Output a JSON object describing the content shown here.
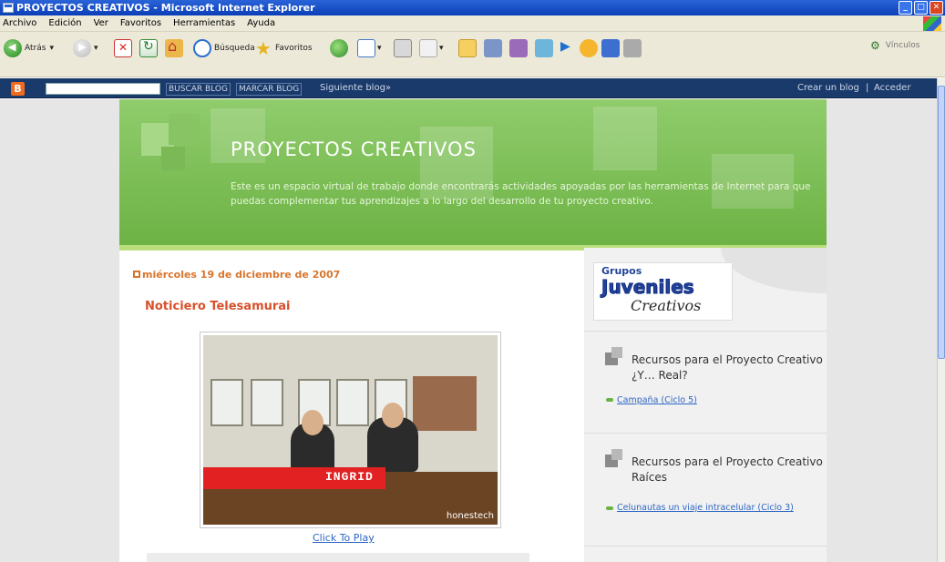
{
  "window": {
    "title": "PROYECTOS CREATIVOS - Microsoft Internet Explorer"
  },
  "menu": [
    "Archivo",
    "Edición",
    "Ver",
    "Favoritos",
    "Herramientas",
    "Ayuda"
  ],
  "toolbar": {
    "back_label": "Atrás",
    "search_label": "Búsqueda",
    "favorites_label": "Favoritos",
    "links_label": "Vínculos"
  },
  "blogger_bar": {
    "search_button": "BUSCAR BLOG",
    "flag_button": "MARCAR BLOG",
    "next_blog": "Siguiente blog»",
    "create_blog": "Crear un blog",
    "separator": "|",
    "login": "Acceder"
  },
  "blog": {
    "title": "PROYECTOS CREATIVOS",
    "description": "Este es un espacio virtual de trabajo donde encontrarás actividades apoyadas por las herramientas de Internet para que puedas complementar tus aprendizajes a lo largo del desarrollo de tu proyecto creativo."
  },
  "post": {
    "date": "miércoles 19 de diciembre de 2007",
    "title": "Noticiero Telesamurai",
    "video_caption": "INGRID",
    "video_brand": "honestech",
    "click_to_play": "Click To Play"
  },
  "sidebar": {
    "badge": {
      "line1": "Grupos",
      "line2": "Juveniles",
      "line3": "Creativos"
    },
    "widgets": [
      {
        "title": "Recursos para el Proyecto Creativo ¿Y… Real?",
        "link": "Campaña (Ciclo 5)"
      },
      {
        "title": "Recursos para el Proyecto Creativo Raíces",
        "link": "Celunautas un viaje intracelular (Ciclo 3)"
      }
    ]
  }
}
